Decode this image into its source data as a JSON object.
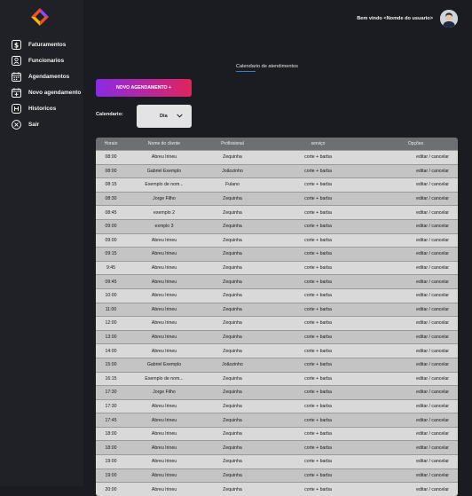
{
  "sidebar": {
    "items": [
      {
        "label": "Faturamentos",
        "icon": "dollar-icon"
      },
      {
        "label": "Funcionarios",
        "icon": "badge-icon"
      },
      {
        "label": "Agendamentos",
        "icon": "calendar-icon"
      },
      {
        "label": "Novo agendamento",
        "icon": "calendar-plus-icon"
      },
      {
        "label": "Historicos",
        "icon": "history-icon"
      },
      {
        "label": "Sair",
        "icon": "close-circle-icon"
      }
    ]
  },
  "header": {
    "welcome": "Bem vindo <Nomde do usuario>"
  },
  "main": {
    "title": "Calendario de atendimentos",
    "new_button": "NOVO AGENDAMENTO +",
    "calendar_label": "Calendario:",
    "calendar_value": "Dia",
    "table": {
      "headers": [
        "Horaio",
        "Nome do cliente",
        "Profissional",
        "serviço",
        "Opções"
      ],
      "action_edit": "editar",
      "action_sep": " / ",
      "action_cancel": "cancelar",
      "rows": [
        [
          "08:00",
          "Abreu Irineu",
          "Zequinha",
          "corte + barba"
        ],
        [
          "08:00",
          "Gabriel Exemplo",
          "Joãozinho",
          "corte + barba"
        ],
        [
          "08:15",
          "Exemplo de nom...",
          "Fulano",
          "corte + barba"
        ],
        [
          "08:30",
          "Jorge Filho",
          "Zequinha",
          "corte + barba"
        ],
        [
          "08:45",
          "exemplo 2",
          "Zequinha",
          "corte + barba"
        ],
        [
          "09:00",
          "exmplo 3",
          "Zequinha",
          "corte + barba"
        ],
        [
          "09:00",
          "Abreu Irineu",
          "Zequinha",
          "corte + barba"
        ],
        [
          "09:15",
          "Abreu Irineu",
          "Zequinha",
          "corte + barba"
        ],
        [
          "9:45",
          "Abreu Irineu",
          "Zequinha",
          "corte + barba"
        ],
        [
          "09:45",
          "Abreu Irineu",
          "Zequinha",
          "corte + barba"
        ],
        [
          "10:00",
          "Abreu Irineu",
          "Zequinha",
          "corte + barba"
        ],
        [
          "11:00",
          "Abreu Irineu",
          "Zequinha",
          "corte + barba"
        ],
        [
          "12:00",
          "Abreu Irineu",
          "Zequinha",
          "corte + barba"
        ],
        [
          "13:00",
          "Abreu Irineu",
          "Zequinha",
          "corte + barba"
        ],
        [
          "14:00",
          "Abreu Irineu",
          "Zequinha",
          "corte + barba"
        ],
        [
          "15:00",
          "Gabriel Exemplo",
          "Joãozinho",
          "corte + barba"
        ],
        [
          "16:15",
          "Exemplo de nom...",
          "Zequinha",
          "corte + barba"
        ],
        [
          "17:30",
          "Jorge Filho",
          "Zequinha",
          "corte + barba"
        ],
        [
          "17:30",
          "Abreu Irineu",
          "Zequinha",
          "corte + barba"
        ],
        [
          "17:45",
          "Abreu Irineu",
          "Zequinha",
          "corte + barba"
        ],
        [
          "18:00",
          "Abreu Irineu",
          "Zequinha",
          "corte + barba"
        ],
        [
          "18:00",
          "Abreu Irineu",
          "Zequinha",
          "corte + barba"
        ],
        [
          "19:00",
          "Abreu Irineu",
          "Zequinha",
          "corte + barba"
        ],
        [
          "19:00",
          "Abreu Irineu",
          "Zequinha",
          "corte + barba"
        ],
        [
          "20:00",
          "Abreu Irineu",
          "Zequinha",
          "corte + barba"
        ]
      ]
    }
  },
  "colors": {
    "background": "#1b1c21",
    "sidebar": "#202127",
    "button_gradient_start": "#8a2be2",
    "button_gradient_end": "#e0245e",
    "title_underline": "#3a7bd5",
    "table_header": "#6e6f73",
    "row_light": "#d9d9d9",
    "row_dark": "#c4c4c4"
  }
}
